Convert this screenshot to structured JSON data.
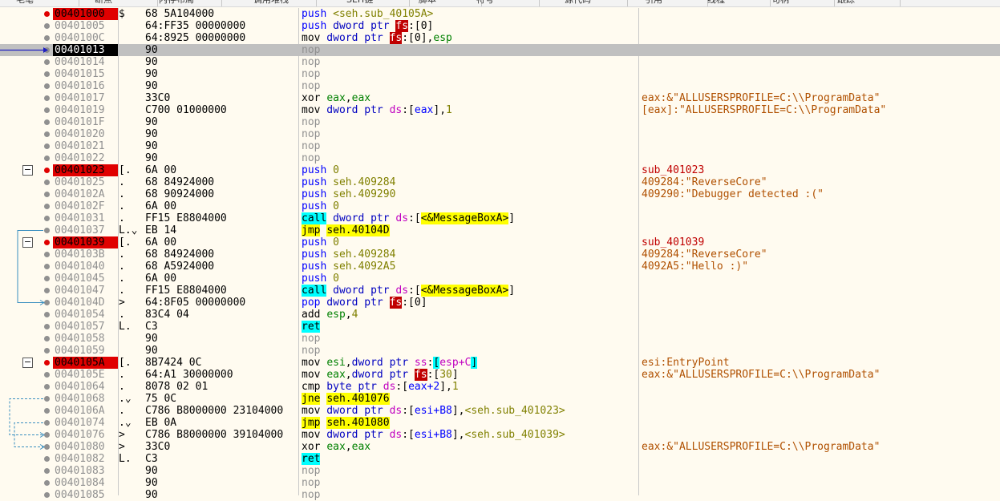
{
  "tabs": [
    "毛笔",
    "断点",
    "内存布局",
    "调用堆栈",
    "SEH链",
    "脚本",
    "符号",
    "源代码",
    "引用",
    "线程",
    "句柄",
    "跟踪"
  ],
  "rows": [
    {
      "addr": "00401000",
      "bp": true,
      "mark": "$",
      "bytes": "68 5A104000",
      "dis": [
        [
          "push",
          "push"
        ],
        [
          " ",
          ""
        ],
        [
          "<seh.sub_40105A>",
          "sym"
        ]
      ],
      "cmt": ""
    },
    {
      "addr": "00401005",
      "mark": "",
      "bytes": "64:FF35 00000000",
      "dis": [
        [
          "push",
          "push"
        ],
        [
          " dword ptr ",
          "keyword"
        ],
        [
          "fs",
          "segfs"
        ],
        [
          ":[0]",
          "plain"
        ]
      ],
      "cmt": ""
    },
    {
      "addr": "0040100C",
      "mark": "",
      "bytes": "64:8925 00000000",
      "dis": [
        [
          "mov",
          "mnemonic"
        ],
        [
          " dword ptr ",
          "keyword"
        ],
        [
          "fs",
          "segfs"
        ],
        [
          ":[0],",
          "plain"
        ],
        [
          "esp",
          "reg"
        ]
      ],
      "cmt": ""
    },
    {
      "addr": "00401013",
      "cur": true,
      "mark": "",
      "bytes": "90",
      "dis": [
        [
          "nop",
          "nop"
        ]
      ],
      "cmt": ""
    },
    {
      "addr": "00401014",
      "mark": "",
      "bytes": "90",
      "dis": [
        [
          "nop",
          "nop"
        ]
      ],
      "cmt": ""
    },
    {
      "addr": "00401015",
      "mark": "",
      "bytes": "90",
      "dis": [
        [
          "nop",
          "nop"
        ]
      ],
      "cmt": ""
    },
    {
      "addr": "00401016",
      "mark": "",
      "bytes": "90",
      "dis": [
        [
          "nop",
          "nop"
        ]
      ],
      "cmt": ""
    },
    {
      "addr": "00401017",
      "mark": "",
      "bytes": "33C0",
      "dis": [
        [
          "xor",
          "mnemonic"
        ],
        [
          " ",
          ""
        ],
        [
          "eax",
          "reg"
        ],
        [
          ",",
          "plain"
        ],
        [
          "eax",
          "reg"
        ]
      ],
      "cmt": "eax:&\"ALLUSERSPROFILE=C:\\\\ProgramData\""
    },
    {
      "addr": "00401019",
      "mark": "",
      "bytes": "C700 01000000",
      "dis": [
        [
          "mov",
          "mnemonic"
        ],
        [
          " dword ptr ",
          "keyword"
        ],
        [
          "ds",
          "seg"
        ],
        [
          ":[",
          "plain"
        ],
        [
          "eax",
          "regm"
        ],
        [
          "],",
          "plain"
        ],
        [
          "1",
          "num"
        ]
      ],
      "cmt": "[eax]:\"ALLUSERSPROFILE=C:\\\\ProgramData\""
    },
    {
      "addr": "0040101F",
      "mark": "",
      "bytes": "90",
      "dis": [
        [
          "nop",
          "nop"
        ]
      ],
      "cmt": ""
    },
    {
      "addr": "00401020",
      "mark": "",
      "bytes": "90",
      "dis": [
        [
          "nop",
          "nop"
        ]
      ],
      "cmt": ""
    },
    {
      "addr": "00401021",
      "mark": "",
      "bytes": "90",
      "dis": [
        [
          "nop",
          "nop"
        ]
      ],
      "cmt": ""
    },
    {
      "addr": "00401022",
      "mark": "",
      "bytes": "90",
      "dis": [
        [
          "nop",
          "nop"
        ]
      ],
      "cmt": ""
    },
    {
      "addr": "00401023",
      "bp": true,
      "fold": "−",
      "mark": "[.",
      "bytes": "6A 00",
      "dis": [
        [
          "push",
          "push"
        ],
        [
          " ",
          ""
        ],
        [
          "0",
          "num"
        ]
      ],
      "cmt": "sub_401023",
      "cmtColor": "#c00000"
    },
    {
      "addr": "00401025",
      "mark": ".",
      "bytes": "68 84924000",
      "dis": [
        [
          "push",
          "push"
        ],
        [
          " ",
          ""
        ],
        [
          "seh.409284",
          "sym"
        ]
      ],
      "cmt": "409284:\"ReverseCore\""
    },
    {
      "addr": "0040102A",
      "mark": ".",
      "bytes": "68 90924000",
      "dis": [
        [
          "push",
          "push"
        ],
        [
          " ",
          ""
        ],
        [
          "seh.409290",
          "sym"
        ]
      ],
      "cmt": "409290:\"Debugger detected :(\""
    },
    {
      "addr": "0040102F",
      "mark": ".",
      "bytes": "6A 00",
      "dis": [
        [
          "push",
          "push"
        ],
        [
          " ",
          ""
        ],
        [
          "0",
          "num"
        ]
      ],
      "cmt": ""
    },
    {
      "addr": "00401031",
      "mark": ".",
      "bytes": "FF15 E8804000",
      "dis": [
        [
          "call",
          "callop"
        ],
        [
          " dword ptr ",
          "keyword"
        ],
        [
          "ds",
          "seg"
        ],
        [
          ":[",
          "plain"
        ],
        [
          "<&MessageBoxA>",
          "api"
        ],
        [
          "]",
          "plain"
        ]
      ],
      "cmt": ""
    },
    {
      "addr": "00401037",
      "mark": "L.⌄",
      "bytes": "EB 14",
      "dis": [
        [
          "jmp",
          "jmp"
        ],
        [
          " ",
          ""
        ],
        [
          "seh.40104D",
          "jtarget"
        ]
      ],
      "cmt": ""
    },
    {
      "addr": "00401039",
      "bp": true,
      "fold": "−",
      "mark": "[.",
      "bytes": "6A 00",
      "dis": [
        [
          "push",
          "push"
        ],
        [
          " ",
          ""
        ],
        [
          "0",
          "num"
        ]
      ],
      "cmt": "sub_401039",
      "cmtColor": "#c00000"
    },
    {
      "addr": "0040103B",
      "mark": ".",
      "bytes": "68 84924000",
      "dis": [
        [
          "push",
          "push"
        ],
        [
          " ",
          ""
        ],
        [
          "seh.409284",
          "sym"
        ]
      ],
      "cmt": "409284:\"ReverseCore\""
    },
    {
      "addr": "00401040",
      "mark": ".",
      "bytes": "68 A5924000",
      "dis": [
        [
          "push",
          "push"
        ],
        [
          " ",
          ""
        ],
        [
          "seh.4092A5",
          "sym"
        ]
      ],
      "cmt": "4092A5:\"Hello :)\""
    },
    {
      "addr": "00401045",
      "mark": ".",
      "bytes": "6A 00",
      "dis": [
        [
          "push",
          "push"
        ],
        [
          " ",
          ""
        ],
        [
          "0",
          "num"
        ]
      ],
      "cmt": ""
    },
    {
      "addr": "00401047",
      "mark": ".",
      "bytes": "FF15 E8804000",
      "dis": [
        [
          "call",
          "callop"
        ],
        [
          " dword ptr ",
          "keyword"
        ],
        [
          "ds",
          "seg"
        ],
        [
          ":[",
          "plain"
        ],
        [
          "<&MessageBoxA>",
          "api"
        ],
        [
          "]",
          "plain"
        ]
      ],
      "cmt": ""
    },
    {
      "addr": "0040104D",
      "mark": ">",
      "bytes": "64:8F05 00000000",
      "dis": [
        [
          "pop",
          "push"
        ],
        [
          " dword ptr ",
          "keyword"
        ],
        [
          "fs",
          "segfs"
        ],
        [
          ":[0]",
          "plain"
        ]
      ],
      "cmt": ""
    },
    {
      "addr": "00401054",
      "mark": ".",
      "bytes": "83C4 04",
      "dis": [
        [
          "add",
          "mnemonic"
        ],
        [
          " ",
          ""
        ],
        [
          "esp",
          "reg"
        ],
        [
          ",",
          "plain"
        ],
        [
          "4",
          "num"
        ]
      ],
      "cmt": ""
    },
    {
      "addr": "00401057",
      "mark": "L.",
      "bytes": "C3",
      "dis": [
        [
          "ret",
          "retop"
        ]
      ],
      "cmt": ""
    },
    {
      "addr": "00401058",
      "mark": "",
      "bytes": "90",
      "dis": [
        [
          "nop",
          "nop"
        ]
      ],
      "cmt": ""
    },
    {
      "addr": "00401059",
      "mark": "",
      "bytes": "90",
      "dis": [
        [
          "nop",
          "nop"
        ]
      ],
      "cmt": ""
    },
    {
      "addr": "0040105A",
      "bp": true,
      "fold": "−",
      "mark": "[.",
      "bytes": "8B7424 0C",
      "dis": [
        [
          "mov",
          "mnemonic"
        ],
        [
          " ",
          ""
        ],
        [
          "esi",
          "reg"
        ],
        [
          ",",
          "plain"
        ],
        [
          "dword ptr ",
          "keyword"
        ],
        [
          "ss",
          "seg"
        ],
        [
          ":",
          "plain"
        ],
        [
          "[",
          "cyanb"
        ],
        [
          "esp+C",
          "stack"
        ],
        [
          "]",
          "cyanb"
        ]
      ],
      "cmt": "esi:EntryPoint"
    },
    {
      "addr": "0040105E",
      "mark": ".",
      "bytes": "64:A1 30000000",
      "dis": [
        [
          "mov",
          "mnemonic"
        ],
        [
          " ",
          ""
        ],
        [
          "eax",
          "reg"
        ],
        [
          ",",
          "plain"
        ],
        [
          "dword ptr ",
          "keyword"
        ],
        [
          "fs",
          "segfs"
        ],
        [
          ":[",
          "plain"
        ],
        [
          "30",
          "num"
        ],
        [
          "]",
          "plain"
        ]
      ],
      "cmt": "eax:&\"ALLUSERSPROFILE=C:\\\\ProgramData\""
    },
    {
      "addr": "00401064",
      "mark": ".",
      "bytes": "8078 02 01",
      "dis": [
        [
          "cmp",
          "mnemonic"
        ],
        [
          " byte ptr ",
          "keyword"
        ],
        [
          "ds",
          "seg"
        ],
        [
          ":[",
          "plain"
        ],
        [
          "eax+2",
          "regm"
        ],
        [
          "],",
          "plain"
        ],
        [
          "1",
          "num"
        ]
      ],
      "cmt": ""
    },
    {
      "addr": "00401068",
      "mark": ".⌄",
      "bytes": "75 0C",
      "dis": [
        [
          "jne",
          "jmp"
        ],
        [
          " ",
          ""
        ],
        [
          "seh.401076",
          "jtarget"
        ]
      ],
      "cmt": ""
    },
    {
      "addr": "0040106A",
      "mark": ".",
      "bytes": "C786 B8000000 23104000",
      "dis": [
        [
          "mov",
          "mnemonic"
        ],
        [
          " dword ptr ",
          "keyword"
        ],
        [
          "ds",
          "seg"
        ],
        [
          ":[",
          "plain"
        ],
        [
          "esi+B8",
          "regm"
        ],
        [
          "],",
          "plain"
        ],
        [
          "<seh.sub_401023>",
          "sym"
        ]
      ],
      "cmt": ""
    },
    {
      "addr": "00401074",
      "mark": ".⌄",
      "bytes": "EB 0A",
      "dis": [
        [
          "jmp",
          "jmp"
        ],
        [
          " ",
          ""
        ],
        [
          "seh.401080",
          "jtarget"
        ]
      ],
      "cmt": ""
    },
    {
      "addr": "00401076",
      "mark": ">",
      "bytes": "C786 B8000000 39104000",
      "dis": [
        [
          "mov",
          "mnemonic"
        ],
        [
          " dword ptr ",
          "keyword"
        ],
        [
          "ds",
          "seg"
        ],
        [
          ":[",
          "plain"
        ],
        [
          "esi+B8",
          "regm"
        ],
        [
          "],",
          "plain"
        ],
        [
          "<seh.sub_401039>",
          "sym"
        ]
      ],
      "cmt": ""
    },
    {
      "addr": "00401080",
      "mark": ">",
      "bytes": "33C0",
      "dis": [
        [
          "xor",
          "mnemonic"
        ],
        [
          " ",
          ""
        ],
        [
          "eax",
          "reg"
        ],
        [
          ",",
          "plain"
        ],
        [
          "eax",
          "reg"
        ]
      ],
      "cmt": "eax:&\"ALLUSERSPROFILE=C:\\\\ProgramData\""
    },
    {
      "addr": "00401082",
      "mark": "L.",
      "bytes": "C3",
      "dis": [
        [
          "ret",
          "retop"
        ]
      ],
      "cmt": ""
    },
    {
      "addr": "00401083",
      "mark": "",
      "bytes": "90",
      "dis": [
        [
          "nop",
          "nop"
        ]
      ],
      "cmt": ""
    },
    {
      "addr": "00401084",
      "mark": "",
      "bytes": "90",
      "dis": [
        [
          "nop",
          "nop"
        ]
      ],
      "cmt": ""
    },
    {
      "addr": "00401085",
      "mark": "",
      "bytes": "90",
      "dis": [
        [
          "nop",
          "nop"
        ]
      ],
      "cmt": ""
    }
  ],
  "colors": {
    "breakpoint": "#e00000",
    "current_row": "#c0c0c0",
    "comment": "#b05000",
    "call_highlight": "#00ffff",
    "jump_highlight": "#ffff00",
    "eip_arrow": "#2020c0",
    "jump_arrow": "#3a8fc0"
  }
}
